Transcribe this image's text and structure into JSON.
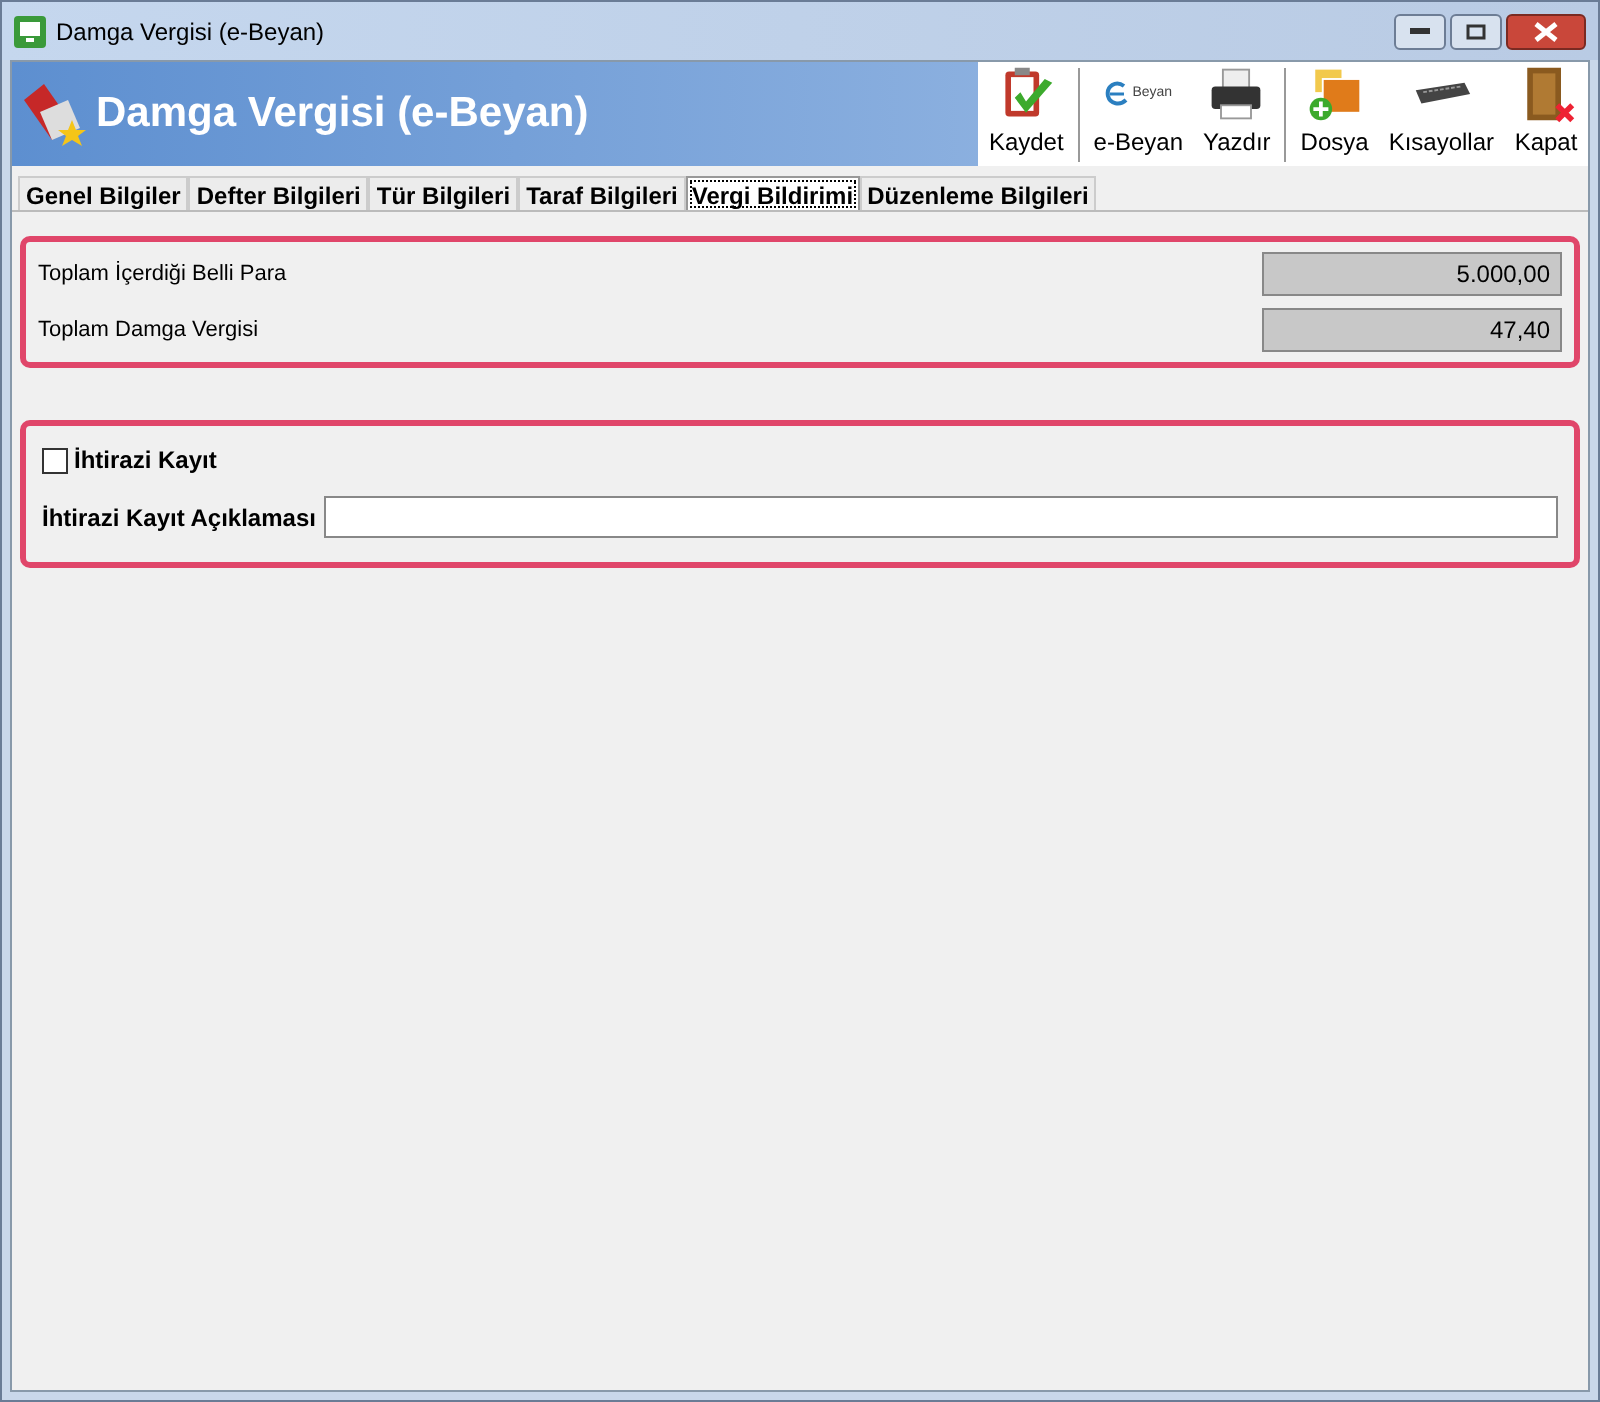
{
  "window": {
    "title": "Damga Vergisi (e-Beyan)"
  },
  "header": {
    "title": "Damga Vergisi (e-Beyan)"
  },
  "toolbar": [
    {
      "kind": "save",
      "label": "Kaydet"
    },
    {
      "kind": "ebeyan",
      "label": "e-Beyan",
      "logo_text": "Beyan"
    },
    {
      "kind": "print",
      "label": "Yazdır"
    },
    {
      "kind": "file",
      "label": "Dosya"
    },
    {
      "kind": "keyboard",
      "label": "Kısayollar"
    },
    {
      "kind": "close",
      "label": "Kapat"
    }
  ],
  "tabs": [
    {
      "label": "Genel Bilgiler",
      "selected": false
    },
    {
      "label": "Defter Bilgileri",
      "selected": false
    },
    {
      "label": "Tür Bilgileri",
      "selected": false
    },
    {
      "label": "Taraf Bilgileri",
      "selected": false
    },
    {
      "label": "Vergi Bildirimi",
      "selected": true
    },
    {
      "label": "Düzenleme Bilgileri",
      "selected": false
    }
  ],
  "totals": [
    {
      "label": "Toplam İçerdiği Belli Para",
      "value": "5.000,00"
    },
    {
      "label": "Toplam Damga Vergisi",
      "value": "47,40"
    }
  ],
  "objection": {
    "checkbox": {
      "label": "İhtirazi Kayıt",
      "checked": false
    },
    "description_label": "İhtirazi Kayıt Açıklaması"
  }
}
